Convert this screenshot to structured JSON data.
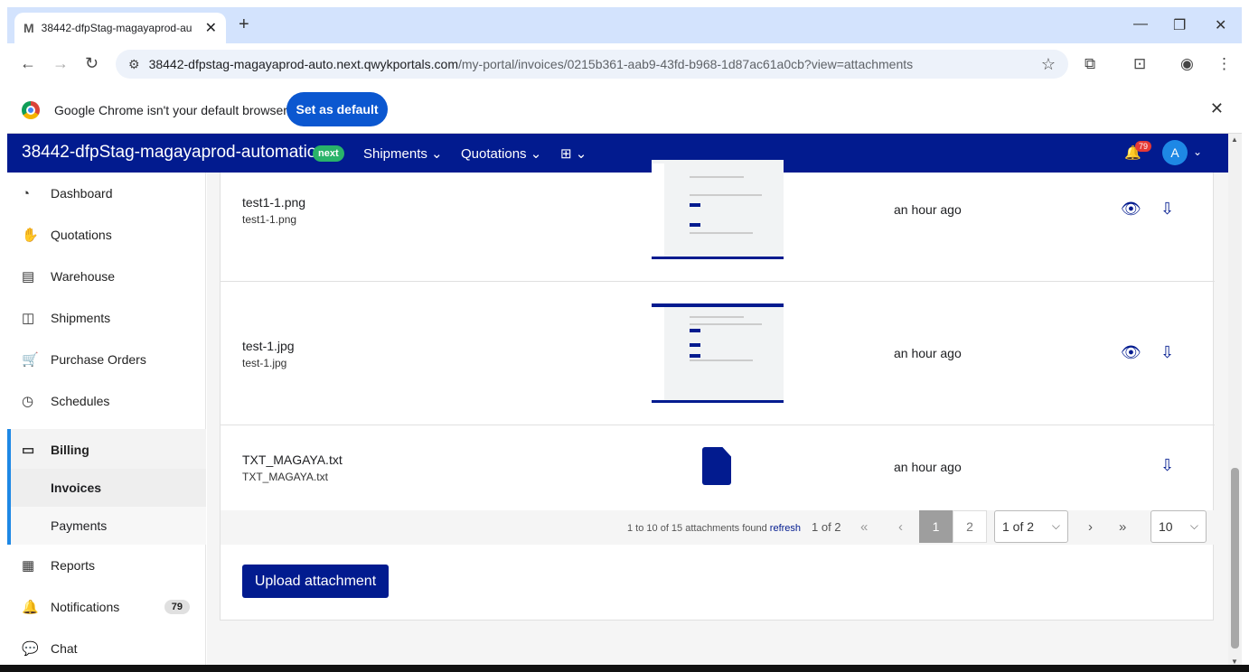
{
  "browser": {
    "tab_title": "38442-dfpStag-magayaprod-au",
    "tab_favicon": "M",
    "url_host": "38442-dfpstag-magayaprod-auto.next.qwykportals.com",
    "url_path": "/my-portal/invoices/0215b361-aab9-43fd-b968-1d87ac61a0cb?view=attachments",
    "infobar_message": "Google Chrome isn't your default browser",
    "infobar_button": "Set as default"
  },
  "header": {
    "brand": "38442-dfpStag-magayaprod-automation",
    "badge": "next",
    "menu": [
      "Shipments",
      "Quotations"
    ],
    "notification_count": "79",
    "avatar": "A",
    "accent_color": "#021b8f"
  },
  "sidebar": {
    "items": [
      {
        "label": "Dashboard",
        "icon": "dashboard-icon"
      },
      {
        "label": "Quotations",
        "icon": "quotations-icon"
      },
      {
        "label": "Warehouse",
        "icon": "warehouse-icon"
      },
      {
        "label": "Shipments",
        "icon": "shipments-icon"
      },
      {
        "label": "Purchase Orders",
        "icon": "cart-icon"
      },
      {
        "label": "Schedules",
        "icon": "clock-icon"
      },
      {
        "label": "Billing",
        "icon": "billing-icon"
      },
      {
        "label": "Reports",
        "icon": "reports-icon"
      },
      {
        "label": "Notifications",
        "icon": "bell-icon"
      },
      {
        "label": "Chat",
        "icon": "chat-icon"
      }
    ],
    "billing_sub": [
      "Invoices",
      "Payments"
    ],
    "notifications_badge": "79"
  },
  "attachments": [
    {
      "name": "test1-1.png",
      "filename": "test1-1.png",
      "time": "an hour ago"
    },
    {
      "name": "test-1.jpg",
      "filename": "test-1.jpg",
      "time": "an hour ago"
    },
    {
      "name": "TXT_MAGAYA.txt",
      "filename": "TXT_MAGAYA.txt",
      "time": "an hour ago"
    }
  ],
  "pager": {
    "found_text": "1 to 10 of 15 attachments found",
    "refresh": "refresh",
    "page_of": "1 of 2",
    "page1": "1",
    "page2": "2",
    "page_select": "1 of 2",
    "page_size": "10"
  },
  "upload_button": "Upload attachment"
}
